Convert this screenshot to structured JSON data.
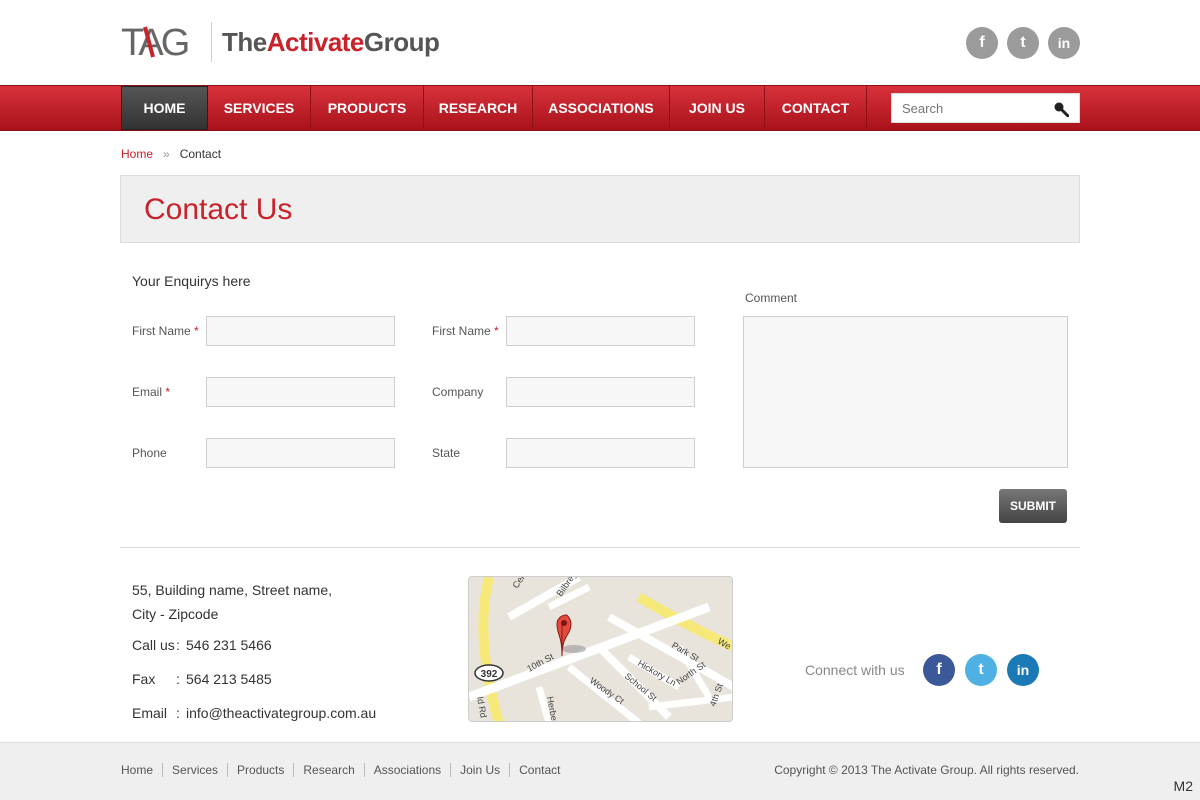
{
  "brand": {
    "mark": "TAG",
    "name_part1": "The",
    "name_part2": "Activate",
    "name_part3": "Group"
  },
  "social_top": [
    {
      "icon": "facebook-icon",
      "glyph": "f"
    },
    {
      "icon": "twitter-icon",
      "glyph": "t"
    },
    {
      "icon": "linkedin-icon",
      "glyph": "in"
    }
  ],
  "nav": {
    "items": [
      {
        "label": "HOME",
        "active": true
      },
      {
        "label": "SERVICES"
      },
      {
        "label": "PRODUCTS"
      },
      {
        "label": "RESEARCH"
      },
      {
        "label": "ASSOCIATIONS"
      },
      {
        "label": "JOIN US"
      },
      {
        "label": "CONTACT"
      }
    ],
    "search_placeholder": "Search"
  },
  "breadcrumb": {
    "home": "Home",
    "sep": "»",
    "current": "Contact"
  },
  "page_title": "Contact Us",
  "form": {
    "heading": "Your Enquirys here",
    "fields": [
      {
        "label": "First Name",
        "required": true
      },
      {
        "label": "Email",
        "required": true
      },
      {
        "label": "Phone",
        "required": false
      },
      {
        "label": "First Name",
        "required": true
      },
      {
        "label": "Company",
        "required": false
      },
      {
        "label": "State",
        "required": false
      }
    ],
    "comment_label": "Comment",
    "submit_label": "SUBMIT",
    "required_mark": "*"
  },
  "contact": {
    "address_line1": "55, Building name, Street name,",
    "address_line2": "City - Zipcode",
    "call_label": "Call us",
    "call_value": "546 231 5466",
    "fax_label": "Fax",
    "fax_value": "564 213 5485",
    "email_label": "Email",
    "email_value": "info@theactivategroup.com.au",
    "colon": ":"
  },
  "map": {
    "labels": [
      "10th St",
      "Hickory Ln",
      "School St",
      "Woody Ct",
      "Park St",
      "North St",
      "Bilbrey St",
      "392",
      "We",
      "Herber",
      "Id Rd",
      "4th St",
      "Cer"
    ]
  },
  "connect": {
    "label": "Connect with us",
    "icons": [
      {
        "icon": "facebook-icon",
        "glyph": "f",
        "color": "#3b5998"
      },
      {
        "icon": "twitter-icon",
        "glyph": "t",
        "color": "#4fb1e3"
      },
      {
        "icon": "linkedin-icon",
        "glyph": "in",
        "color": "#1b7ab5"
      }
    ]
  },
  "footer": {
    "links": [
      "Home",
      "Services",
      "Products",
      "Research",
      "Associations",
      "Join Us",
      "Contact"
    ],
    "copyright": "Copyright  ©  2013   The Activate Group.   All rights reserved.",
    "corner": "M2"
  },
  "colors": {
    "brand_red": "#c8222b",
    "nav_dark": "#333333"
  }
}
